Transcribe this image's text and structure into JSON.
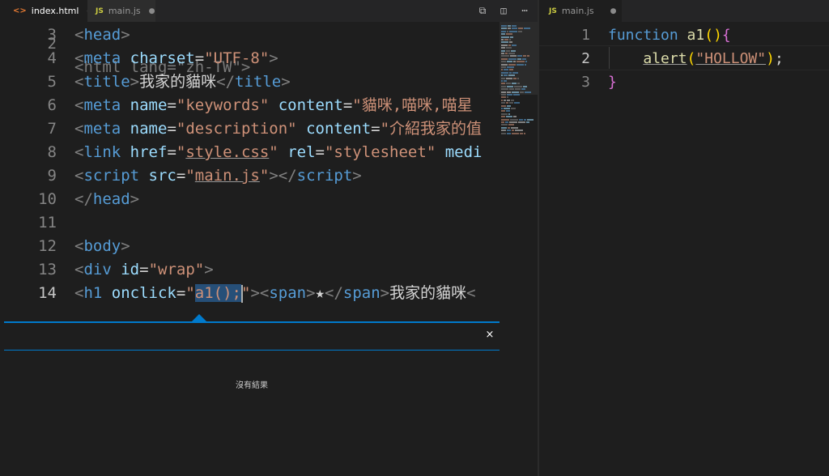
{
  "left_pane": {
    "tabs": [
      {
        "label": "index.html",
        "icon": "html-file-icon",
        "glyph": "<>",
        "modified_dot": "●",
        "active": true
      },
      {
        "label": "main.js",
        "icon": "js-file-icon",
        "glyph": "JS",
        "modified_dot": "●",
        "active": false
      }
    ],
    "toolbar": {
      "open_changes_icon": "⧉",
      "split_editor_icon": "◫",
      "more_actions_icon": "⋯"
    },
    "partial_top_line": {
      "num": "2",
      "text": "<html lang=\"zh-TW\">"
    },
    "lines": [
      {
        "num": "3",
        "t": [
          "<",
          "head",
          ">"
        ]
      },
      {
        "num": "4",
        "t": [
          "<",
          "meta",
          " ",
          "charset",
          "=",
          "\"UTF-8\"",
          ">"
        ]
      },
      {
        "num": "5",
        "t": [
          "<",
          "title",
          ">",
          "我家的貓咪",
          "</",
          "title",
          ">"
        ]
      },
      {
        "num": "6",
        "t": [
          "<",
          "meta",
          " ",
          "name",
          "=",
          "\"keywords\"",
          " ",
          "content",
          "=",
          "\"貓咪,喵咪,喵星"
        ]
      },
      {
        "num": "7",
        "t": [
          "<",
          "meta",
          " ",
          "name",
          "=",
          "\"description\"",
          " ",
          "content",
          "=",
          "\"介紹我家的值"
        ]
      },
      {
        "num": "8",
        "t": [
          "<",
          "link",
          " ",
          "href",
          "=",
          "\"",
          "style.css",
          "\"",
          " ",
          "rel",
          "=",
          "\"stylesheet\"",
          " ",
          "medi"
        ]
      },
      {
        "num": "9",
        "t": [
          "<",
          "script",
          " ",
          "src",
          "=",
          "\"",
          "main.js",
          "\"",
          "></",
          "script",
          ">"
        ]
      },
      {
        "num": "10",
        "t": [
          "</",
          "head",
          ">"
        ]
      },
      {
        "num": "11",
        "t": []
      },
      {
        "num": "12",
        "t": [
          "<",
          "body",
          ">"
        ]
      },
      {
        "num": "13",
        "t": [
          "<",
          "div",
          " ",
          "id",
          "=",
          "\"wrap\"",
          ">"
        ]
      },
      {
        "num": "14",
        "t": [
          "<",
          "h1",
          " ",
          "onclick",
          "=",
          "\"",
          "a1();",
          "\"",
          "><",
          "span",
          ">",
          "★",
          "</",
          "span",
          ">",
          "我家的貓咪",
          "<"
        ]
      }
    ]
  },
  "peek_widget": {
    "close_icon": "×",
    "message": "沒有結果"
  },
  "right_pane": {
    "tab": {
      "label": "main.js",
      "icon": "js-file-icon",
      "glyph": "JS",
      "modified_dot": "●"
    },
    "lines": [
      {
        "num": "1",
        "t": [
          "function",
          " ",
          "a1",
          "()",
          "{"
        ]
      },
      {
        "num": "2",
        "t": [
          "    ",
          "alert",
          "(",
          "\"HOLLOW\"",
          ")",
          ";"
        ]
      },
      {
        "num": "3",
        "t": [
          "}"
        ]
      }
    ]
  },
  "colors": {
    "background": "#1e1e1e",
    "accent": "#007acc",
    "tag": "#569cd6",
    "attribute": "#9cdcfe",
    "string": "#ce9178",
    "function": "#dcdcaa",
    "selection": "#264f78"
  }
}
